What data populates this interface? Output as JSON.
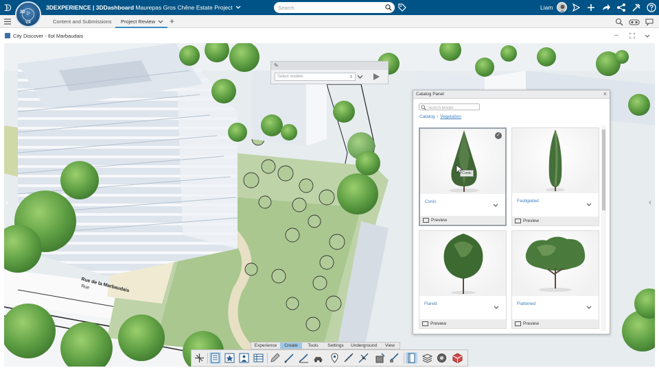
{
  "app": {
    "brand": "3DEXPERIENCE | 3DDashboard",
    "project": "Maurepas Gros Chêne Estate Project",
    "search_placeholder": "Search",
    "user": "Liam",
    "compass": {
      "top": "3D",
      "center": "▷",
      "bottom": "V,R"
    }
  },
  "tabs": [
    {
      "label": "Content and Submissions"
    },
    {
      "label": "Project Review",
      "active": true
    }
  ],
  "widget": {
    "title": "City Discover - Ilot Marbaudais"
  },
  "street_label": "Rue de la Marbaudais",
  "street_label_small": "Rue",
  "model_selector": {
    "placeholder": "Select models"
  },
  "catalog": {
    "title": "Catalog Panel",
    "search_placeholder": "Search Model",
    "breadcrumb": [
      "Catalog",
      "Vegetation"
    ],
    "items": [
      {
        "name": "Conic",
        "preview": "Preview",
        "selected": true,
        "tooltip": "Conic"
      },
      {
        "name": "Fastigiated",
        "preview": "Preview"
      },
      {
        "name": "Flared",
        "preview": "Preview"
      },
      {
        "name": "Flattened",
        "preview": "Preview"
      }
    ]
  },
  "action_tabs": [
    "Experience",
    "Create",
    "Tools",
    "Settings",
    "Underground",
    "View"
  ],
  "active_action_tab": "Create",
  "colors": {
    "topbar": "#005386",
    "accent": "#368ec4",
    "link": "#3a7fbf",
    "active_tab": "#9ec7e5"
  }
}
